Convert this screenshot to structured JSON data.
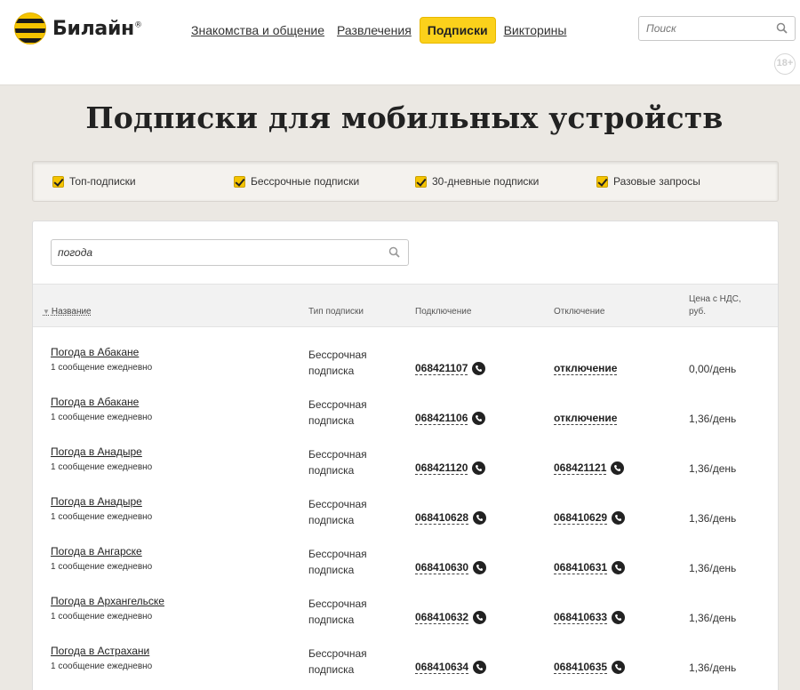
{
  "header": {
    "logo_text": "Билайн",
    "logo_mark": "®",
    "nav": [
      {
        "label": "Знакомства и общение",
        "active": false
      },
      {
        "label": "Развлечения",
        "active": false
      },
      {
        "label": "Подписки",
        "active": true
      },
      {
        "label": "Викторины",
        "active": false
      }
    ],
    "search_placeholder": "Поиск",
    "age_badge": "18+"
  },
  "page_title": "Подписки для мобильных устройств",
  "filters": [
    {
      "label": "Топ-подписки",
      "checked": true
    },
    {
      "label": "Бессрочные подписки",
      "checked": true
    },
    {
      "label": "30-дневные подписки",
      "checked": true
    },
    {
      "label": "Разовые запросы",
      "checked": true
    }
  ],
  "search": {
    "value": "погода"
  },
  "table": {
    "columns": {
      "name": "Название",
      "type": "Тип подписки",
      "connect": "Подключение",
      "disconnect": "Отключение",
      "price": "Цена с НДС, руб."
    },
    "rows": [
      {
        "name": "Погода в Абакане",
        "desc": "1 сообщение ежедневно",
        "type": "Бессрочная подписка",
        "connect": "068421107",
        "disconnect": "отключение",
        "disconnect_has_phone": false,
        "price": "0,00/день"
      },
      {
        "name": "Погода в Абакане",
        "desc": "1 сообщение ежедневно",
        "type": "Бессрочная подписка",
        "connect": "068421106",
        "disconnect": "отключение",
        "disconnect_has_phone": false,
        "price": "1,36/день"
      },
      {
        "name": "Погода в Анадыре",
        "desc": "1 сообщение ежедневно",
        "type": "Бессрочная подписка",
        "connect": "068421120",
        "disconnect": "068421121",
        "disconnect_has_phone": true,
        "price": "1,36/день"
      },
      {
        "name": "Погода в Анадыре",
        "desc": "1 сообщение ежедневно",
        "type": "Бессрочная подписка",
        "connect": "068410628",
        "disconnect": "068410629",
        "disconnect_has_phone": true,
        "price": "1,36/день"
      },
      {
        "name": "Погода в Ангарске",
        "desc": "1 сообщение ежедневно",
        "type": "Бессрочная подписка",
        "connect": "068410630",
        "disconnect": "068410631",
        "disconnect_has_phone": true,
        "price": "1,36/день"
      },
      {
        "name": "Погода в Архангельске",
        "desc": "1 сообщение ежедневно",
        "type": "Бессрочная подписка",
        "connect": "068410632",
        "disconnect": "068410633",
        "disconnect_has_phone": true,
        "price": "1,36/день"
      },
      {
        "name": "Погода в Астрахани",
        "desc": "1 сообщение ежедневно",
        "type": "Бессрочная подписка",
        "connect": "068410634",
        "disconnect": "068410635",
        "disconnect_has_phone": true,
        "price": "1,36/день"
      }
    ]
  },
  "icons": {
    "search": "magnifier-icon",
    "phone": "phone-icon",
    "checkbox": "checkbox-checked-icon",
    "sort": "sort-arrow-icon"
  },
  "colors": {
    "brand_yellow": "#fbd11b",
    "background": "#ebe8e3",
    "text": "#222222"
  }
}
